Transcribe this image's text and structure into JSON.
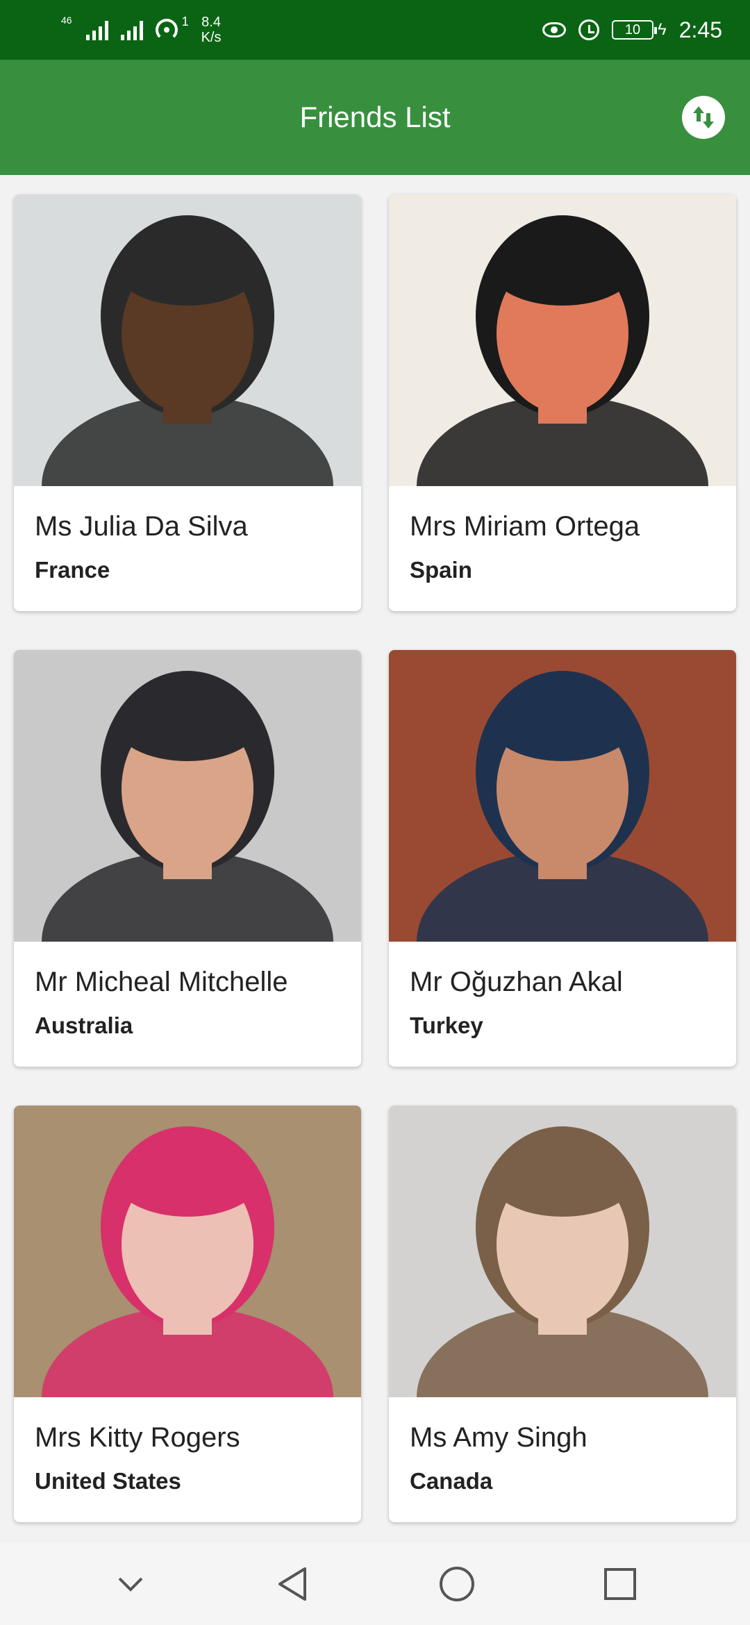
{
  "status_bar": {
    "network_label": "46",
    "hotspot_superscript": "1",
    "speed_value": "8.4",
    "speed_unit": "K/s",
    "battery_level": "10",
    "time": "2:45"
  },
  "app_bar": {
    "title": "Friends List",
    "sort_icon": "sort-arrows-icon"
  },
  "friends": [
    {
      "name": "Ms Julia Da Silva",
      "country": "France",
      "photo_colors": [
        "#d8dcdc",
        "#5a3a24",
        "#2a2a2a"
      ]
    },
    {
      "name": "Mrs Miriam Ortega",
      "country": "Spain",
      "photo_colors": [
        "#f0ece4",
        "#e07a5a",
        "#1a1a1a"
      ]
    },
    {
      "name": "Mr Micheal Mitchelle",
      "country": "Australia",
      "photo_colors": [
        "#c9c9c9",
        "#d9a488",
        "#2a2a2e"
      ]
    },
    {
      "name": "Mr Oğuzhan Akal",
      "country": "Turkey",
      "photo_colors": [
        "#9a4a32",
        "#c88a6a",
        "#1e3250"
      ]
    },
    {
      "name": "Mrs Kitty Rogers",
      "country": "United States",
      "photo_colors": [
        "#a89070",
        "#ecc0b4",
        "#d8306a"
      ]
    },
    {
      "name": "Ms Amy Singh",
      "country": "Canada",
      "photo_colors": [
        "#d4d2d0",
        "#e8c8b4",
        "#7a6048"
      ]
    }
  ],
  "nav_bar": {
    "icons": [
      "chevron-down-icon",
      "back-icon",
      "home-icon",
      "recents-icon"
    ]
  },
  "colors": {
    "status_bar": "#0a6414",
    "app_bar": "#38903f",
    "background": "#f2f2f2"
  }
}
